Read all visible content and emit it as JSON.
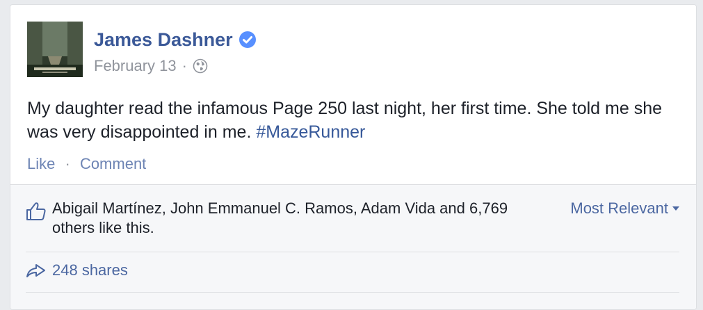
{
  "post": {
    "author": "James Dashner",
    "avatar_alt": "THE MAZE RUNNER",
    "date": "February 13",
    "separator": "·",
    "text": "My daughter read the infamous Page 250 last night, her first time. She told me she was very disappointed in me.",
    "hashtag": "#MazeRunner",
    "icons": {
      "verified": "verified-badge-icon",
      "privacy": "globe-icon"
    }
  },
  "actions": {
    "like_label": "Like",
    "separator": "·",
    "comment_label": "Comment"
  },
  "feedback": {
    "likes_text": "Abigail Martínez, John Emmanuel C. Ramos, Adam Vida and 6,769 others like this.",
    "sort_label": "Most Relevant",
    "shares_label": "248 shares",
    "icons": {
      "like": "thumbs-up-icon",
      "share": "share-arrow-icon",
      "sort": "caret-down-icon"
    }
  },
  "colors": {
    "link_blue": "#3b5998",
    "muted_gray": "#90949c",
    "verified_blue": "#5890ff",
    "feedback_bg": "#f6f7f9"
  }
}
